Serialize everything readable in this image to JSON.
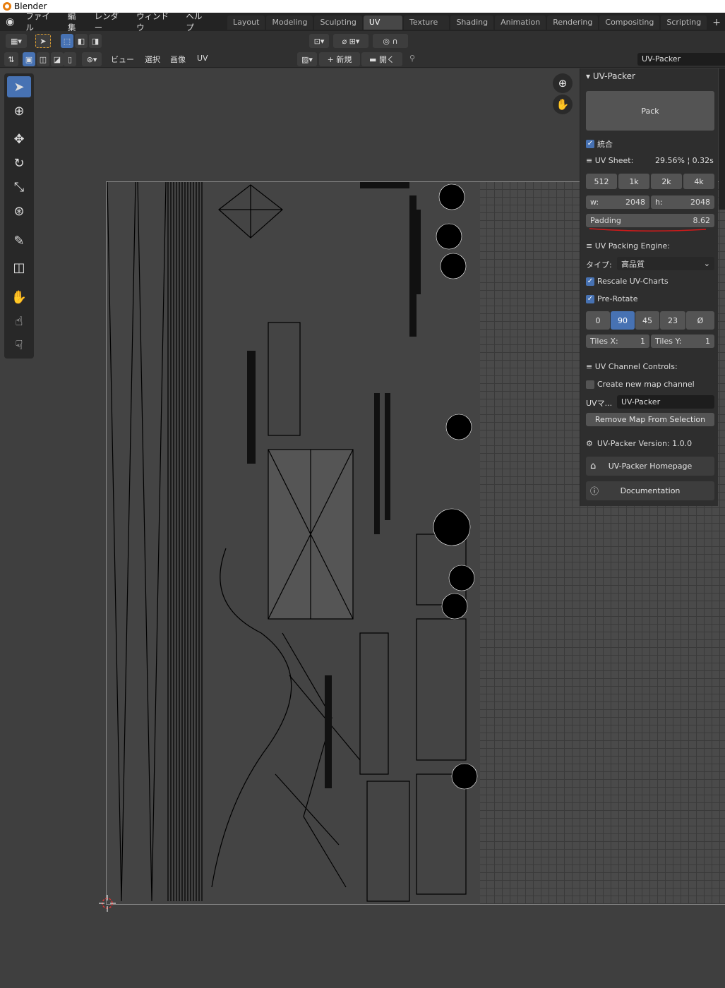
{
  "title_bar": {
    "title": "Blender"
  },
  "menu": {
    "items": [
      "ファイル",
      "編集",
      "レンダー",
      "ウィンドウ",
      "ヘルプ"
    ]
  },
  "workspaces": {
    "tabs": [
      "Layout",
      "Modeling",
      "Sculpting",
      "UV Editing",
      "Texture Paint",
      "Shading",
      "Animation",
      "Rendering",
      "Compositing",
      "Scripting"
    ],
    "active": "UV Editing"
  },
  "uv_header": {
    "view": "ビュー",
    "select": "選択",
    "image": "画像",
    "uv": "UV",
    "new": "新規",
    "open": "開く",
    "image_name": "UV-Packer"
  },
  "panel": {
    "title": "UV-Packer",
    "pack_label": "Pack",
    "combine_label": "統合",
    "uv_sheet_label": "UV Sheet:",
    "uv_sheet_stats": "29.56% ¦ 0.32s",
    "sizes": [
      "512",
      "1k",
      "2k",
      "4k"
    ],
    "w_label": "w:",
    "w_value": "2048",
    "h_label": "h:",
    "h_value": "2048",
    "padding_label": "Padding",
    "padding_value": "8.62",
    "engine_label": "UV Packing Engine:",
    "type_label": "タイプ:",
    "type_value": "高品質",
    "rescale_label": "Rescale UV-Charts",
    "prerotate_label": "Pre-Rotate",
    "rotations": [
      "0",
      "90",
      "45",
      "23",
      "Ø"
    ],
    "active_rotation": "90",
    "tiles_x_label": "Tiles X:",
    "tiles_x": "1",
    "tiles_y_label": "Tiles Y:",
    "tiles_y": "1",
    "channel_label": "UV Channel Controls:",
    "create_label": "Create new map channel",
    "uvmap_label": "UVマ...",
    "uvmap_value": "UV-Packer",
    "remove_label": "Remove Map From Selection",
    "version_label": "UV-Packer Version: 1.0.0",
    "homepage_label": "UV-Packer Homepage",
    "docs_label": "Documentation"
  },
  "colors": {
    "accent": "#4772b3",
    "annotation": "#d11a1a"
  }
}
